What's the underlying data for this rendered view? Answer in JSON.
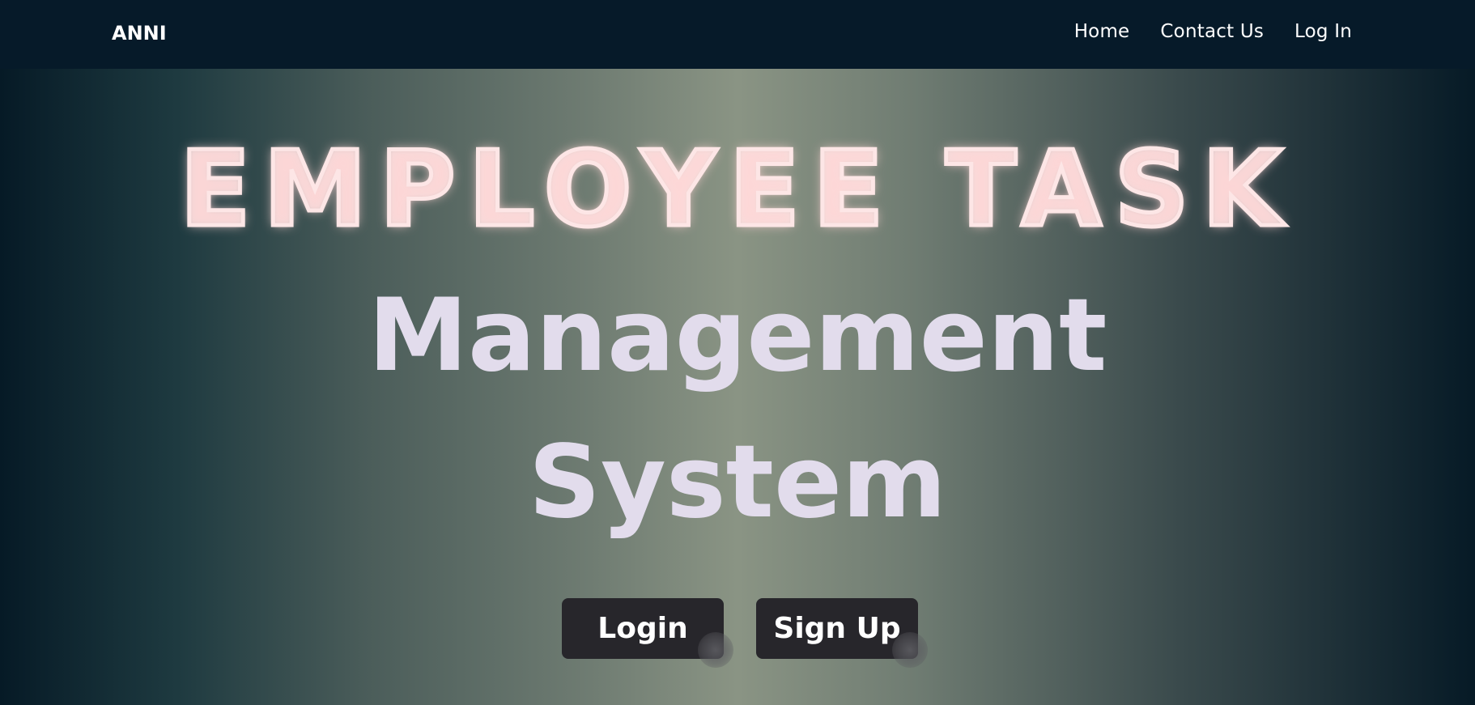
{
  "navbar": {
    "brand": "ANNI",
    "links": [
      "Home",
      "Contact Us",
      "Log In"
    ]
  },
  "hero": {
    "title_outline": "EMPLOYEE TASK",
    "title_line_1": "Management",
    "title_line_2": "System",
    "buttons": {
      "login": "Login",
      "signup": "Sign Up"
    }
  },
  "colors": {
    "navbar_bg": "#061a29",
    "button_bg": "#27262b",
    "title_fill": "#e2dcec",
    "outline_glow": "#fde6e6"
  }
}
